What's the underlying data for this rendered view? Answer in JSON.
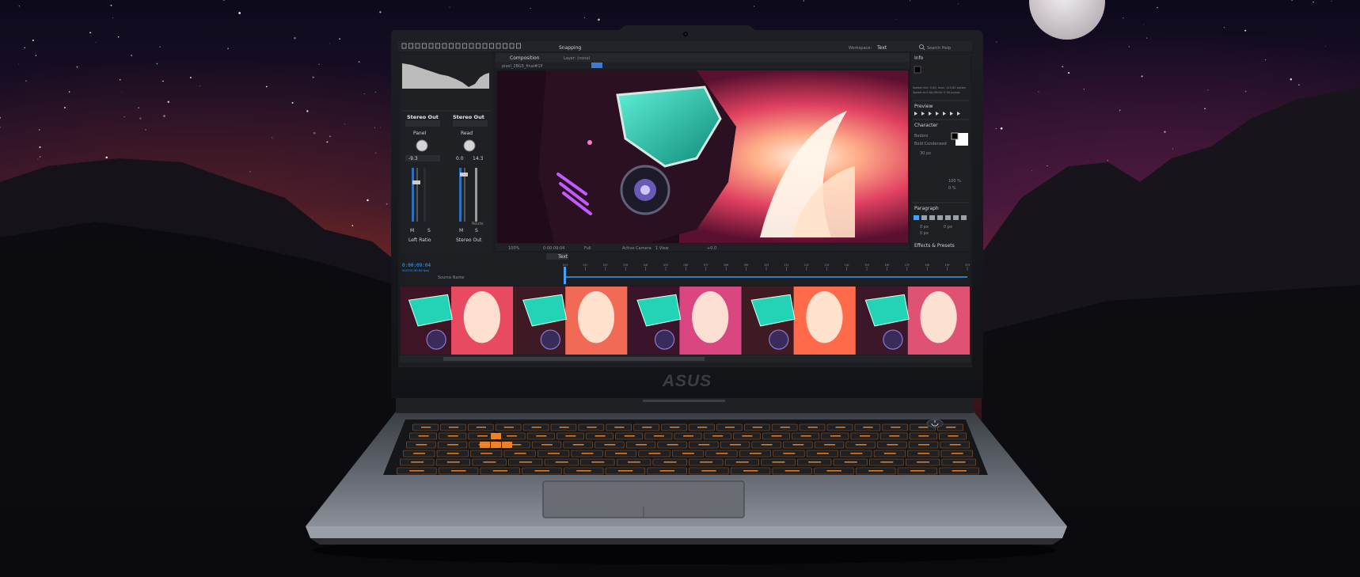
{
  "brand": {
    "logo_text": "ASUS"
  },
  "app": {
    "toolbar": {
      "snapping_label": "Snapping",
      "workspace_label": "Workspace:",
      "workspace_value": "Text",
      "search_label": "Search Help"
    },
    "composition": {
      "tab_label": "Composition",
      "layer_label": "Layer: (none)",
      "comp_name": "pixel_2BG5_final#1P",
      "zoom": "100%",
      "timecode_viewer": "0:00:09:04",
      "quality": "Full",
      "camera": "Active Camera",
      "view": "1 View",
      "offset": "+0.0"
    },
    "audio_mixer": {
      "left": {
        "title": "Stereo Out",
        "knob_label": "Panel",
        "value": "-9.3",
        "mute": "M",
        "solo": "S",
        "bottom_label": "Left Ratio"
      },
      "right": {
        "title": "Stereo Out",
        "knob_label": "Read",
        "value": "0.0",
        "secondary_value": "14.3",
        "mute": "M",
        "solo": "S",
        "extra": "Route",
        "bottom_label": "Stereo Out"
      }
    },
    "info_panel": {
      "title": "Info",
      "speed_line_1": "Speed min: 0.00, max: 115.62 px/sec",
      "speed_line_2": "Speed at 0:00:09:04: 0.00 px/sec"
    },
    "preview_panel": {
      "title": "Preview"
    },
    "character_panel": {
      "title": "Character",
      "font_family": "Bodoni",
      "font_style": "Bold Condensed",
      "size": "30 px",
      "tracking": "100 %",
      "scale": "0 %"
    },
    "paragraph_panel": {
      "title": "Paragraph",
      "indent_a": "0 px",
      "indent_b": "0 px",
      "indent_c": "0 px",
      "footer": "Effects & Presets"
    },
    "timeline": {
      "timecode": "0:00:09:04",
      "fps": "00274 (30.00 fps)",
      "comp_tab": "Text",
      "source_header": "Source Name",
      "ruler_ticks": [
        "00f",
        "01f",
        "02f",
        "03f",
        "04f",
        "05f",
        "06f",
        "07f",
        "08f",
        "09f",
        "10f",
        "11f",
        "12f",
        "13f",
        "14f",
        "15f",
        "16f",
        "17f",
        "18f",
        "19f",
        "20f"
      ]
    },
    "film_strip": {
      "frame_count": 5
    }
  },
  "colors": {
    "keyboard_backlight": "#ff8c2a",
    "ui_accent": "#3fa3ff",
    "neon_teal": "#22d3b5",
    "neon_purple": "#b44dff",
    "neon_pink": "#ff5a6e",
    "laptop_body": "#5c5f66"
  },
  "icons": [
    "webcam-icon",
    "power-button-icon",
    "play-icon",
    "selection-tool-icon",
    "search-icon",
    "asus-logo"
  ]
}
